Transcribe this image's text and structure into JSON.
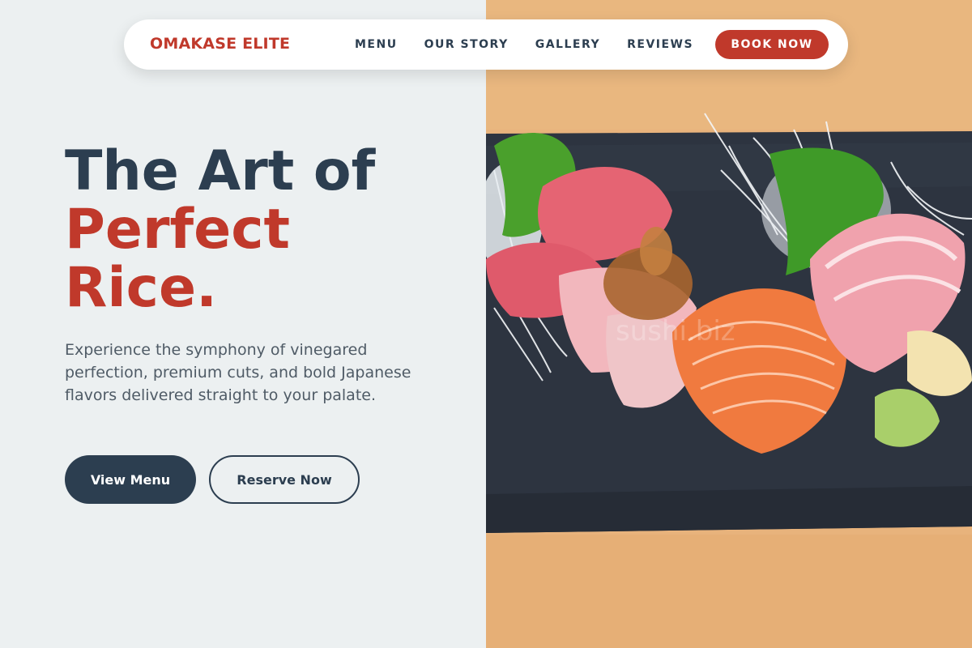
{
  "nav": {
    "brand": "OMAKASE ELITE",
    "links": [
      {
        "label": "MENU"
      },
      {
        "label": "OUR STORY"
      },
      {
        "label": "GALLERY"
      },
      {
        "label": "REVIEWS"
      }
    ],
    "cta": "BOOK NOW"
  },
  "hero": {
    "title_line1": "The Art of",
    "title_accent_line2": "Perfect",
    "title_accent_line3": "Rice.",
    "description": "Experience the symphony of vinegared perfection, premium cuts, and bold Japanese flavors delivered straight to your palate.",
    "primary_button": "View Menu",
    "secondary_button": "Reserve Now"
  },
  "colors": {
    "accent": "#c0392b",
    "dark": "#2c3e50",
    "background": "#ecf0f1"
  },
  "image": {
    "subject": "sashimi-platter",
    "watermark": "sushi.biz"
  }
}
